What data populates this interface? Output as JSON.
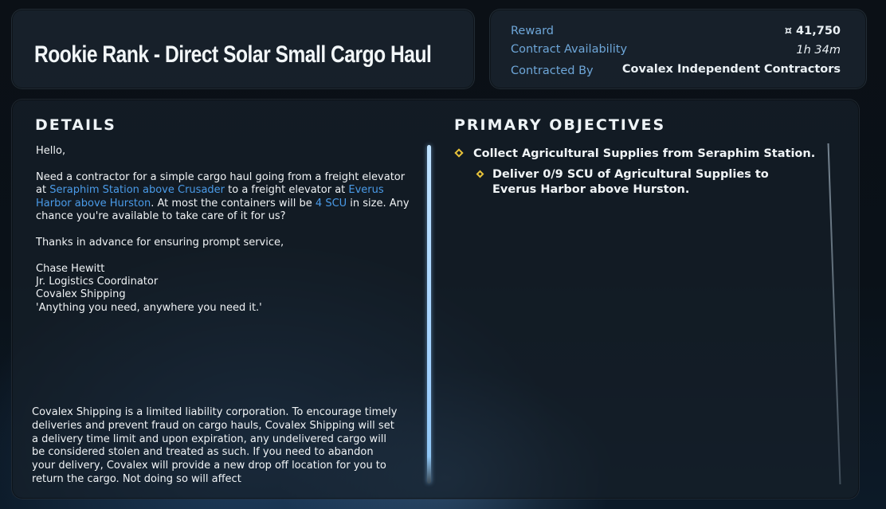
{
  "header": {
    "title": "Rookie Rank - Direct Solar Small Cargo Haul"
  },
  "info": {
    "reward_label": "Reward",
    "reward_value": "¤ 41,750",
    "availability_label": "Contract Availability",
    "availability_value": "1h 34m",
    "contracted_by_label": "Contracted By",
    "contracted_by_value": "Covalex Independent Contractors"
  },
  "details": {
    "heading": "DETAILS",
    "greeting": "Hello,",
    "para1_a": "Need a contractor for a simple cargo haul going from a freight elevator at ",
    "para1_loc1": "Seraphim Station above Crusader",
    "para1_b": " to a freight elevator at ",
    "para1_loc2": "Everus Harbor above Hurston",
    "para1_c": ". At most the containers will be ",
    "para1_size": "4 SCU",
    "para1_d": " in size. Any chance you're available to take care of it for us?",
    "thanks": "Thanks in advance for ensuring prompt service,",
    "sig_name": "Chase Hewitt",
    "sig_role": "Jr. Logistics Coordinator",
    "sig_company": "Covalex Shipping",
    "sig_motto": "'Anything you need, anywhere you need it.'",
    "disclaimer": "Covalex Shipping is a limited liability corporation. To encourage timely deliveries and prevent fraud on cargo hauls, Covalex Shipping will set a delivery time limit and upon expiration, any undelivered cargo will be considered stolen and treated as such. If you need to abandon your delivery, Covalex will provide a new drop off location for you to return the cargo. Not doing so will affect"
  },
  "objectives": {
    "heading": "PRIMARY OBJECTIVES",
    "items": [
      {
        "text": "Collect Agricultural Supplies from Seraphim Station."
      },
      {
        "text": "Deliver 0/9 SCU of Agricultural Supplies to Everus Harbor above Hurston."
      }
    ]
  },
  "colors": {
    "accent": "#4a9be8",
    "label": "#6ea6d8",
    "objective_marker": "#e8c33a"
  }
}
